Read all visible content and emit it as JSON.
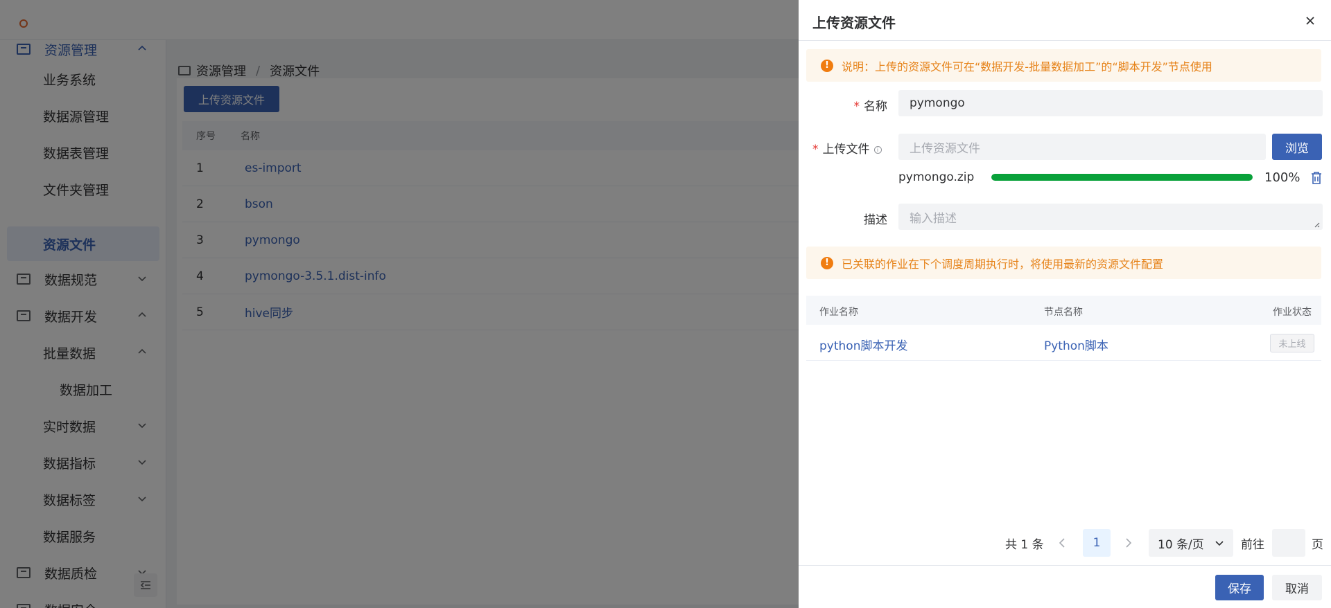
{
  "sidebar": {
    "items": [
      {
        "label": "资源管理",
        "icon": "monitor-icon",
        "expanded": true
      },
      {
        "label": "业务系统"
      },
      {
        "label": "数据源管理"
      },
      {
        "label": "数据表管理"
      },
      {
        "label": "文件夹管理"
      },
      {
        "label": "资源文件",
        "active": true
      },
      {
        "label": "数据规范",
        "icon": "monitor-icon"
      },
      {
        "label": "数据开发",
        "icon": "code-icon",
        "expanded": true
      },
      {
        "label": "批量数据",
        "expanded": true
      },
      {
        "label": "数据加工"
      },
      {
        "label": "实时数据"
      },
      {
        "label": "数据指标"
      },
      {
        "label": "数据标签"
      },
      {
        "label": "数据服务"
      },
      {
        "label": "数据质检",
        "icon": "monitor-icon"
      },
      {
        "label": "数据安全",
        "icon": "checkbox-icon"
      }
    ]
  },
  "breadcrumb": {
    "root": "资源管理",
    "current": "资源文件"
  },
  "main": {
    "upload_button": "上传资源文件",
    "table": {
      "headers": [
        "序号",
        "名称"
      ],
      "rows": [
        {
          "idx": "1",
          "name": "es-import"
        },
        {
          "idx": "2",
          "name": "bson"
        },
        {
          "idx": "3",
          "name": "pymongo"
        },
        {
          "idx": "4",
          "name": "pymongo-3.5.1.dist-info"
        },
        {
          "idx": "5",
          "name": "hive同步"
        }
      ]
    }
  },
  "drawer": {
    "title": "上传资源文件",
    "notice_top": "说明：上传的资源文件可在“数据开发-批量数据加工”的“脚本开发”节点使用",
    "form": {
      "name_label": "名称",
      "name_value": "pymongo",
      "file_label": "上传文件",
      "file_placeholder": "上传资源文件",
      "browse_label": "浏览",
      "desc_label": "描述",
      "desc_placeholder": "输入描述"
    },
    "upload": {
      "file_name": "pymongo.zip",
      "progress": 100,
      "progress_text": "100%"
    },
    "notice_bottom": "已关联的作业在下个调度周期执行时，将使用最新的资源文件配置",
    "jobs_table": {
      "headers": [
        "作业名称",
        "节点名称",
        "作业状态"
      ],
      "rows": [
        {
          "job": "python脚本开发",
          "node": "Python脚本",
          "status": "未上线"
        }
      ]
    },
    "pagination": {
      "total_text": "共 1 条",
      "current_page": "1",
      "page_size": "10 条/页",
      "goto_prefix": "前往",
      "goto_suffix": "页"
    },
    "footer": {
      "save": "保存",
      "cancel": "取消"
    }
  },
  "colors": {
    "primary": "#3a62b4",
    "warning": "#f07c0f",
    "success": "#09a13a",
    "danger": "#e53935"
  }
}
